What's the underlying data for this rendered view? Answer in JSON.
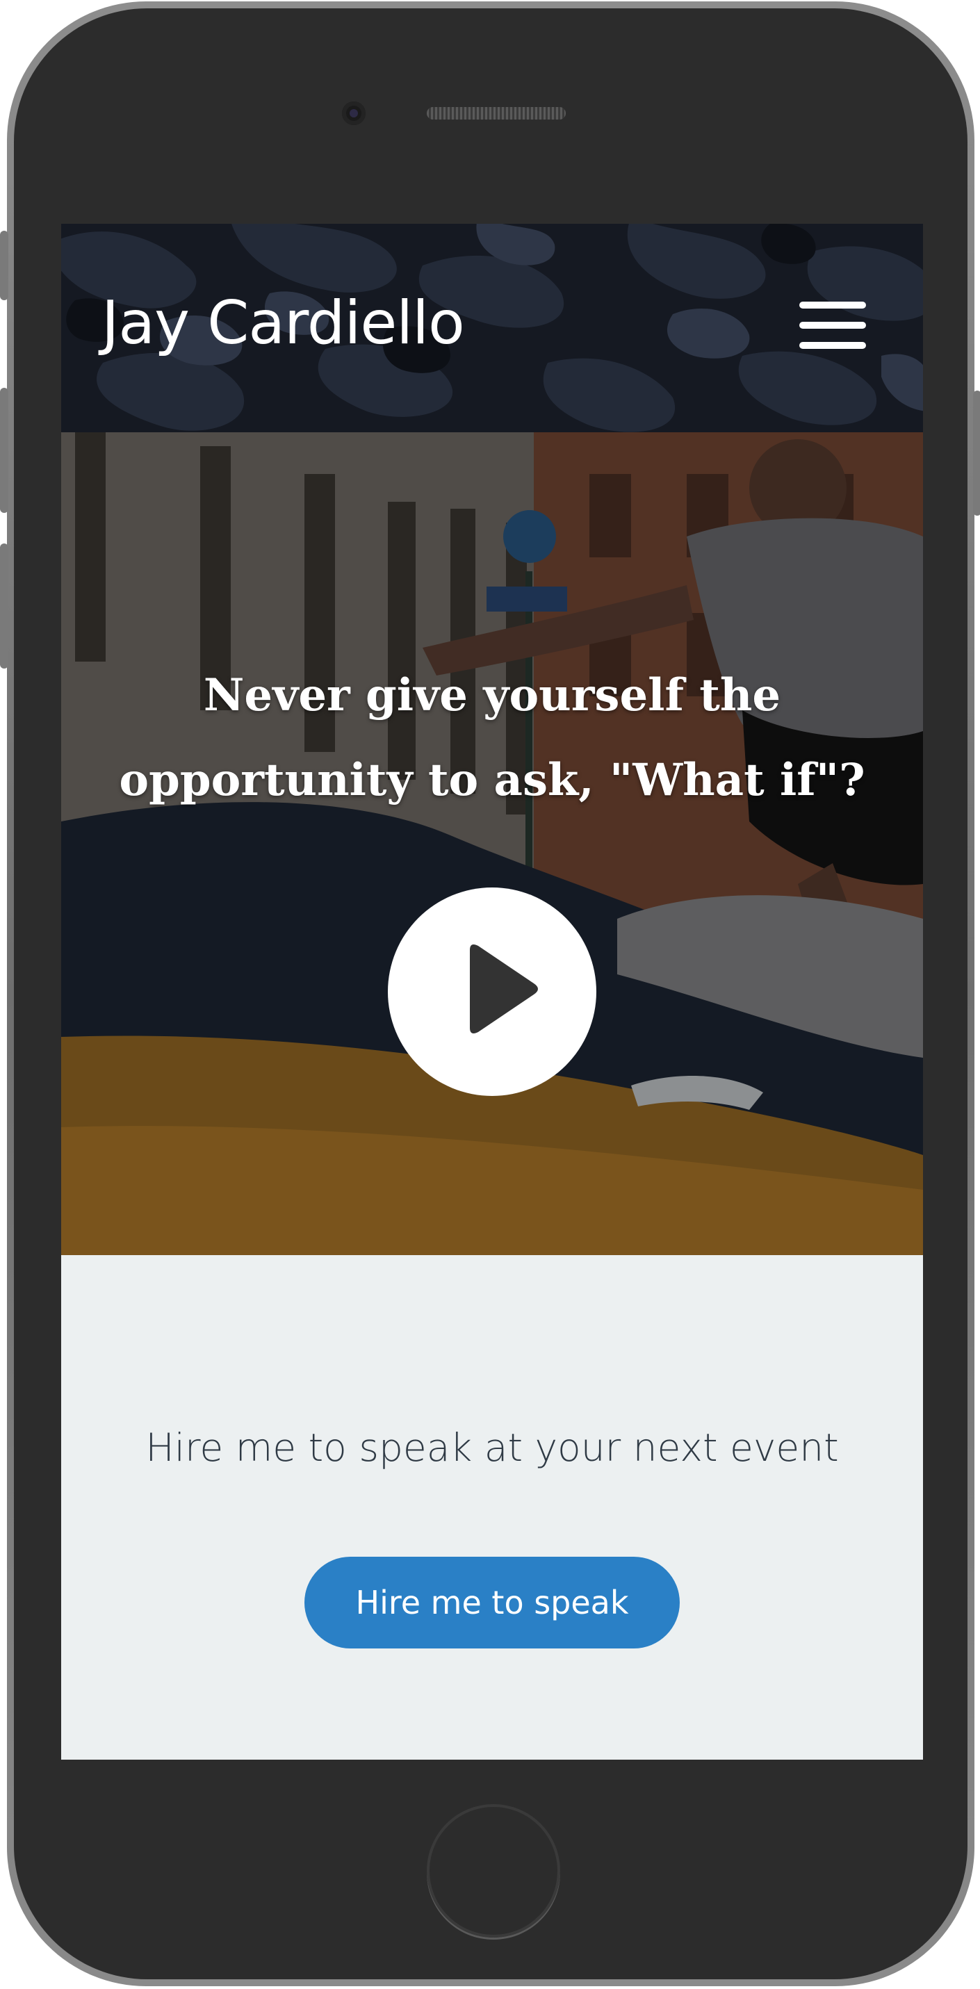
{
  "header": {
    "brand": "Jay Cardiello",
    "menu_icon": "hamburger-menu-icon"
  },
  "hero": {
    "quote_line1": "Never give yourself the",
    "quote_line2": "opportunity to ask, \"What if\"?",
    "play_icon": "play-icon"
  },
  "cta": {
    "text": "Hire me to speak at your next event",
    "button_label": "Hire me to speak"
  },
  "colors": {
    "accent": "#2a80c6",
    "header_bg": "#161a22",
    "cta_bg": "#ecf0f1",
    "text_dark": "#2f3a45"
  }
}
